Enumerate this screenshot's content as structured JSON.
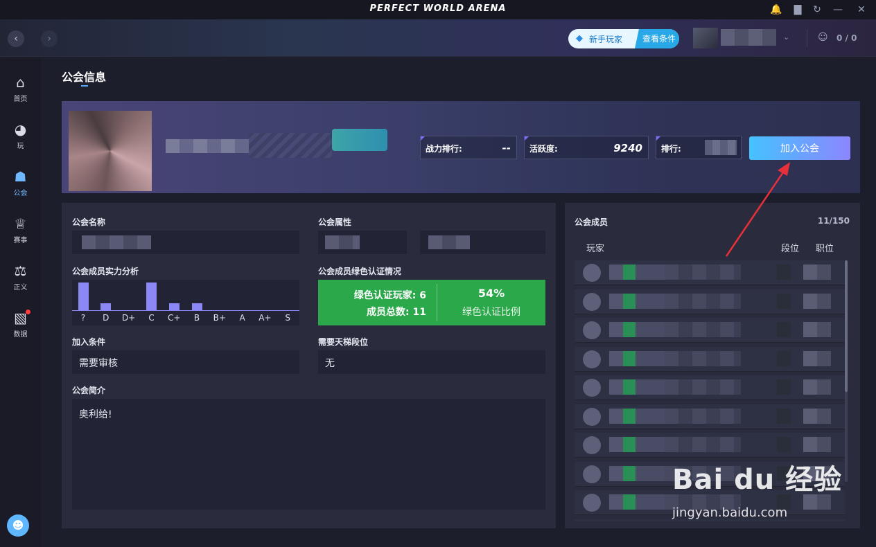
{
  "app": {
    "title": "PERFECT WORLD ARENA"
  },
  "header": {
    "newbie_label": "新手玩家",
    "newbie_conditions": "查看条件",
    "friends_count": "0 / 0"
  },
  "sidebar": {
    "items": [
      {
        "label": "首页",
        "icon": "home-icon"
      },
      {
        "label": "玩",
        "icon": "game-icon"
      },
      {
        "label": "公会",
        "icon": "guild-icon"
      },
      {
        "label": "赛事",
        "icon": "trophy-icon"
      },
      {
        "label": "正义",
        "icon": "scales-icon"
      },
      {
        "label": "数据",
        "icon": "chart-icon"
      }
    ]
  },
  "page": {
    "title": "公会信息"
  },
  "banner": {
    "combat_rank_label": "战力排行:",
    "combat_rank_value": "--",
    "activity_label": "活跃度:",
    "activity_value": "9240",
    "rank_label": "排行:",
    "join_button": "加入公会"
  },
  "info": {
    "name_label": "公会名称",
    "attribute_label": "公会属性",
    "strength_label": "公会成员实力分析",
    "green_label": "公会成员绿色认证情况",
    "join_condition_label": "加入条件",
    "join_condition_value": "需要审核",
    "ladder_label": "需要天梯段位",
    "ladder_value": "无",
    "intro_label": "公会简介",
    "intro_value": "奥利给!",
    "green": {
      "certified_label": "绿色认证玩家:",
      "certified_value": "6",
      "total_label": "成员总数:",
      "total_value": "11",
      "ratio_value": "54%",
      "ratio_label": "绿色认证比例"
    }
  },
  "chart_data": {
    "type": "bar",
    "categories": [
      "?",
      "D",
      "D+",
      "C",
      "C+",
      "B",
      "B+",
      "A",
      "A+",
      "S"
    ],
    "values": [
      4,
      1,
      0,
      4,
      1,
      1,
      0,
      0,
      0,
      0
    ],
    "title": "公会成员实力分析",
    "color": "#8b87f5"
  },
  "members": {
    "title": "公会成员",
    "count": "11/150",
    "columns": [
      "玩家",
      "段位",
      "职位"
    ],
    "row_count": 11
  },
  "watermark": {
    "brand": "Bai du 经验",
    "site": "jingyan.baidu.com"
  }
}
